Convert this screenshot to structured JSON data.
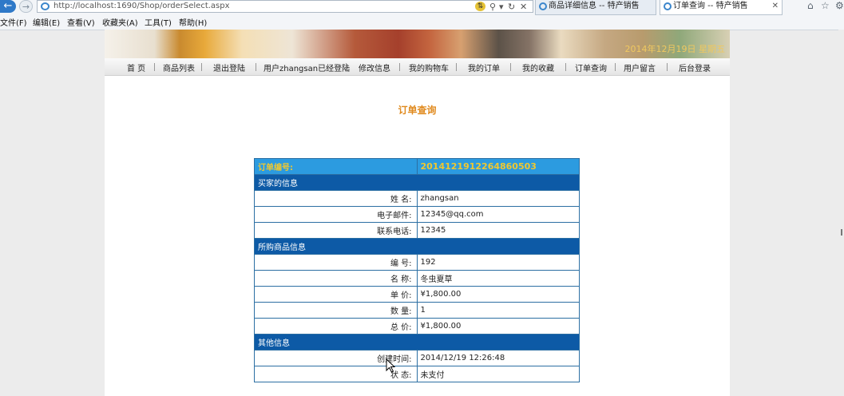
{
  "browser": {
    "back_icon": "back-arrow-icon",
    "forward_icon": "forward-arrow-icon",
    "url": "http://localhost:1690/Shop/orderSelect.aspx",
    "tabs": [
      {
        "label": "商品详细信息 -- 特产销售",
        "active": false
      },
      {
        "label": "订单查询 -- 特产销售",
        "active": true
      }
    ],
    "menu": [
      "文件(F)",
      "编辑(E)",
      "查看(V)",
      "收藏夹(A)",
      "工具(T)",
      "帮助(H)"
    ]
  },
  "banner": {
    "text": "2014年12月19日 星期五"
  },
  "nav": [
    "首 页",
    "商品列表",
    "退出登陆",
    "用户zhangsan已经登陆",
    "修改信息",
    "我的购物车",
    "我的订单",
    "我的收藏",
    "订单查询",
    "用户留言",
    "后台登录"
  ],
  "page": {
    "heading": "订单查询"
  },
  "order": {
    "number_label": "订单编号:",
    "number_value": "20141219122648605​03",
    "buyer_section": "买家的信息",
    "buyer": [
      {
        "label": "姓 名:",
        "value": "zhangsan"
      },
      {
        "label": "电子邮件:",
        "value": "12345@qq.com"
      },
      {
        "label": "联系电话:",
        "value": "12345"
      }
    ],
    "goods_section": "所购商品信息",
    "goods": [
      {
        "label": "编 号:",
        "value": "192"
      },
      {
        "label": "名 称:",
        "value": "冬虫夏草"
      },
      {
        "label": "单 价:",
        "value": "¥1,800.00"
      },
      {
        "label": "数 量:",
        "value": "1"
      },
      {
        "label": "总 价:",
        "value": "¥1,800.00"
      }
    ],
    "other_section": "其他信息",
    "other": [
      {
        "label": "创建时间:",
        "value": "2014/12/19 12:26:48"
      },
      {
        "label": "状 态:",
        "value": "未支付"
      }
    ]
  }
}
